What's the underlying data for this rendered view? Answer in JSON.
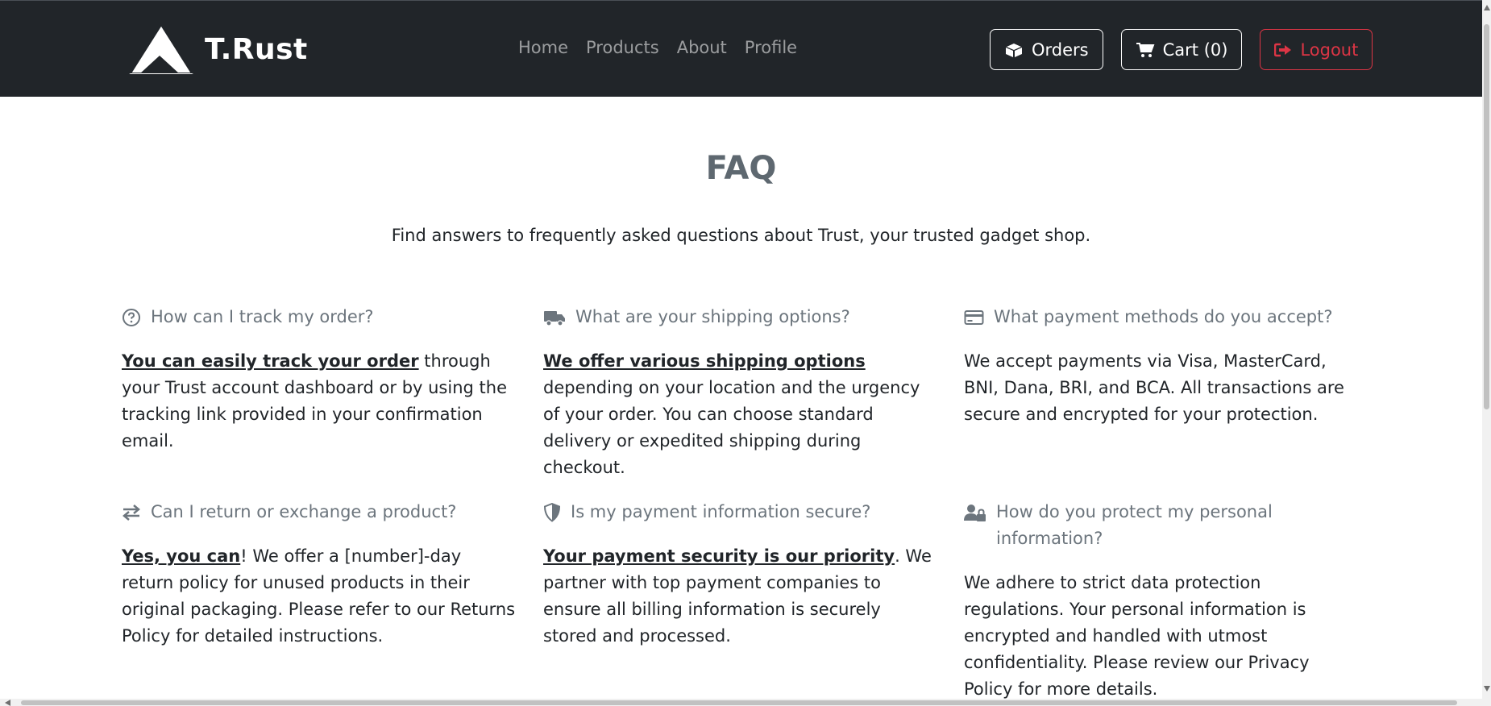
{
  "brand": {
    "name": "T.Rust",
    "logo": "mountain-logo"
  },
  "nav": {
    "links": [
      {
        "label": "Home"
      },
      {
        "label": "Products"
      },
      {
        "label": "About"
      },
      {
        "label": "Profile"
      }
    ],
    "actions": {
      "orders": {
        "label": "Orders",
        "icon": "boxes-icon"
      },
      "cart": {
        "label": "Cart (0)",
        "icon": "cart-icon"
      },
      "logout": {
        "label": "Logout",
        "icon": "sign-out-icon"
      }
    }
  },
  "faq": {
    "title": "FAQ",
    "lead": "Find answers to frequently asked questions about Trust, your trusted gadget shop.",
    "items": [
      {
        "icon": "question-circle-icon",
        "question": "How can I track my order?",
        "answer_bold": "You can easily track your order",
        "answer_rest": " through your Trust account dashboard or by using the tracking link provided in your confirmation email."
      },
      {
        "icon": "truck-icon",
        "question": "What are your shipping options?",
        "answer_bold": "We offer various shipping options",
        "answer_rest": " depending on your location and the urgency of your order. You can choose standard delivery or expedited shipping during checkout."
      },
      {
        "icon": "credit-card-icon",
        "question": "What payment methods do you accept?",
        "answer_bold": "",
        "answer_rest": "We accept payments via Visa, MasterCard, BNI, Dana, BRI, and BCA. All transactions are secure and encrypted for your protection."
      },
      {
        "icon": "exchange-icon",
        "question": "Can I return or exchange a product?",
        "answer_bold": "Yes, you can",
        "answer_rest": "! We offer a [number]-day return policy for unused products in their original packaging. Please refer to our Returns Policy for detailed instructions."
      },
      {
        "icon": "shield-icon",
        "question": "Is my payment information secure?",
        "answer_bold": "Your payment security is our priority",
        "answer_rest": ". We partner with top payment companies to ensure all billing information is securely stored and processed."
      },
      {
        "icon": "user-lock-icon",
        "question": "How do you protect my personal information?",
        "answer_bold": "",
        "answer_rest": "We adhere to strict data protection regulations. Your personal information is encrypted and handled with utmost confidentiality. Please review our Privacy Policy for more details."
      }
    ]
  },
  "colors": {
    "navbar": "#212529",
    "muted": "#6c757d",
    "danger": "#dc3545"
  }
}
